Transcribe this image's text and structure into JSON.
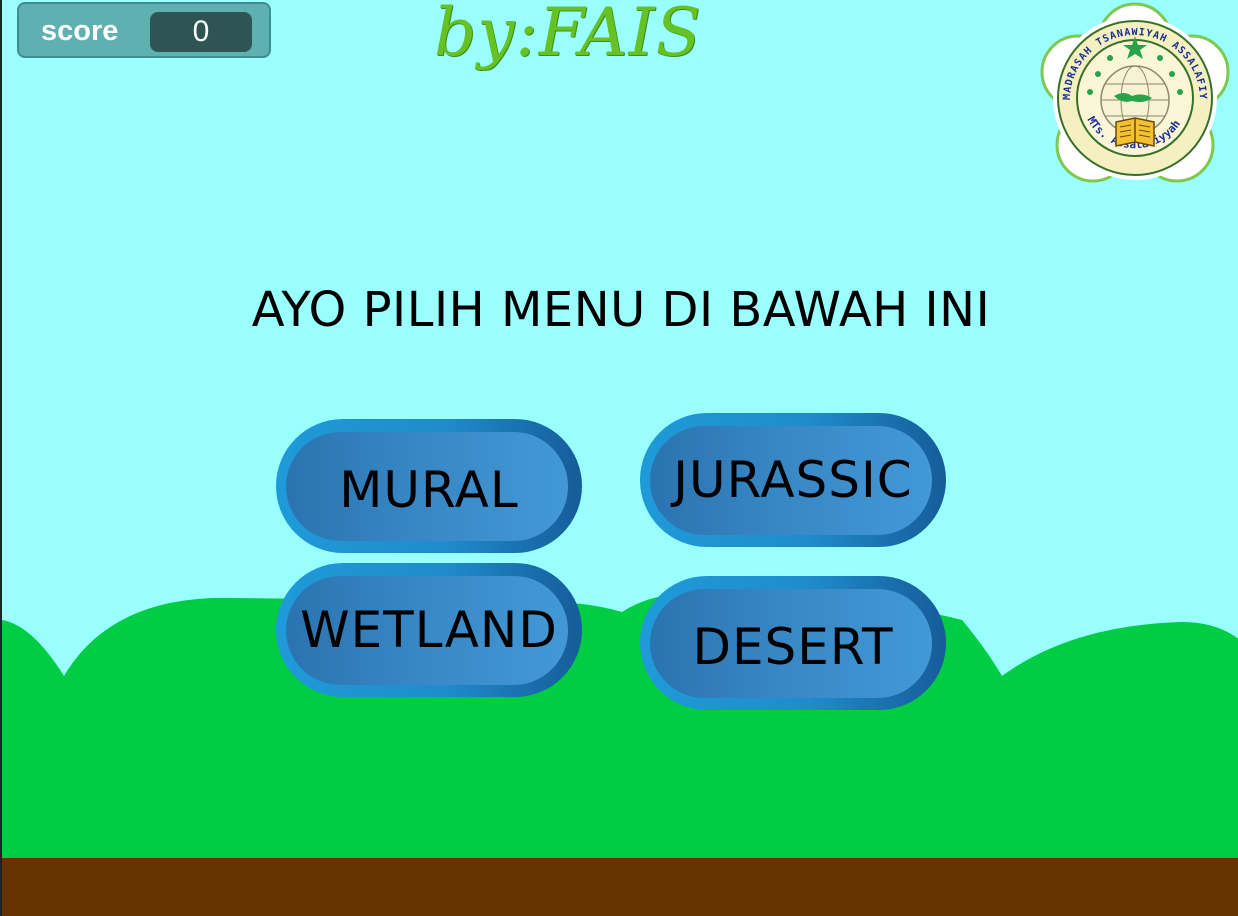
{
  "score": {
    "label": "score",
    "value": "0"
  },
  "byline": "by:FAIS",
  "heading": "AYO PILIH MENU DI BAWAH INI",
  "menu": {
    "mural": "MURAL",
    "jurassic": "JURASSIC",
    "wetland": "WETLAND",
    "desert": "DESERT"
  },
  "logo": {
    "ring_text": "MADRASAH TSANAWIYAH ASSALAFIYYAH",
    "bottom_text": "MTs. Assalafiyyah"
  },
  "colors": {
    "sky": "#99ffff",
    "grass": "#00cc44",
    "ground": "#663300",
    "button": "#3787c4",
    "byline": "#66c224"
  }
}
